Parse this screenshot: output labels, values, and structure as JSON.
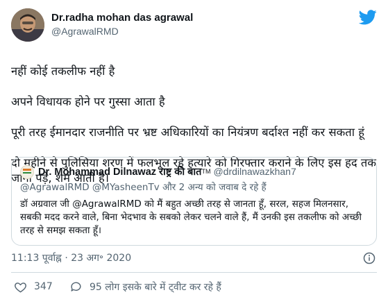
{
  "tweet": {
    "author": {
      "display_name": "Dr.radha mohan das agrawal",
      "handle": "@AgrawalRMD"
    },
    "text_lines": [
      "नहीं कोई तकलीफ नहीं है",
      "अपने विधायक होने पर गुस्सा आता है",
      "पूरी तरह ईमानदार राजनीति पर भ्रष्ट अधिकारियों का नियंत्रण बर्दाश्त नहीं कर सकता हूं",
      "दो महीने से पुलिसिया शरण में फलभूल रहे हत्यारे को गिरफ्तार कराने के लिए इस हद तक जाना पड़े, शर्म आती है।"
    ],
    "time": "11:13 पूर्वाह्न · 23 अग॰ 2020",
    "likes": "347",
    "discussion": "95 लोग इसके बारे में ट्वीट कर रहे हैं"
  },
  "quoted": {
    "display_name": "Dr. Mohammad Dilnawaz राष्ट्र की बात",
    "tm": "TM",
    "handle": "@drdilnawazkhan7",
    "reply_to": "@AgrawalRMD @MYasheenTv और 2 अन्य को जवाब दे रहे हैं",
    "text": "डॉ अग्रवाल जी @AgrawalRMD को मैं बहुत अच्छी तरह से जानता हूँ, सरल, सहज मिलनसार, सबकी मदद करने वाले, बिना भेदभाव के सबको लेकर चलने वाले हैं, मैं उनकी इस तकलीफ को अच्छी तरह से समझ सकता हूँ।"
  },
  "icons": {
    "brand": "twitter-bird-icon",
    "info": "info-icon",
    "like": "heart-icon",
    "discussion": "speech-bubble-icon"
  },
  "colors": {
    "twitter_blue": "#1d9bf0",
    "text_primary": "#0f1419",
    "text_secondary": "#536471",
    "border": "#cfd9de"
  }
}
